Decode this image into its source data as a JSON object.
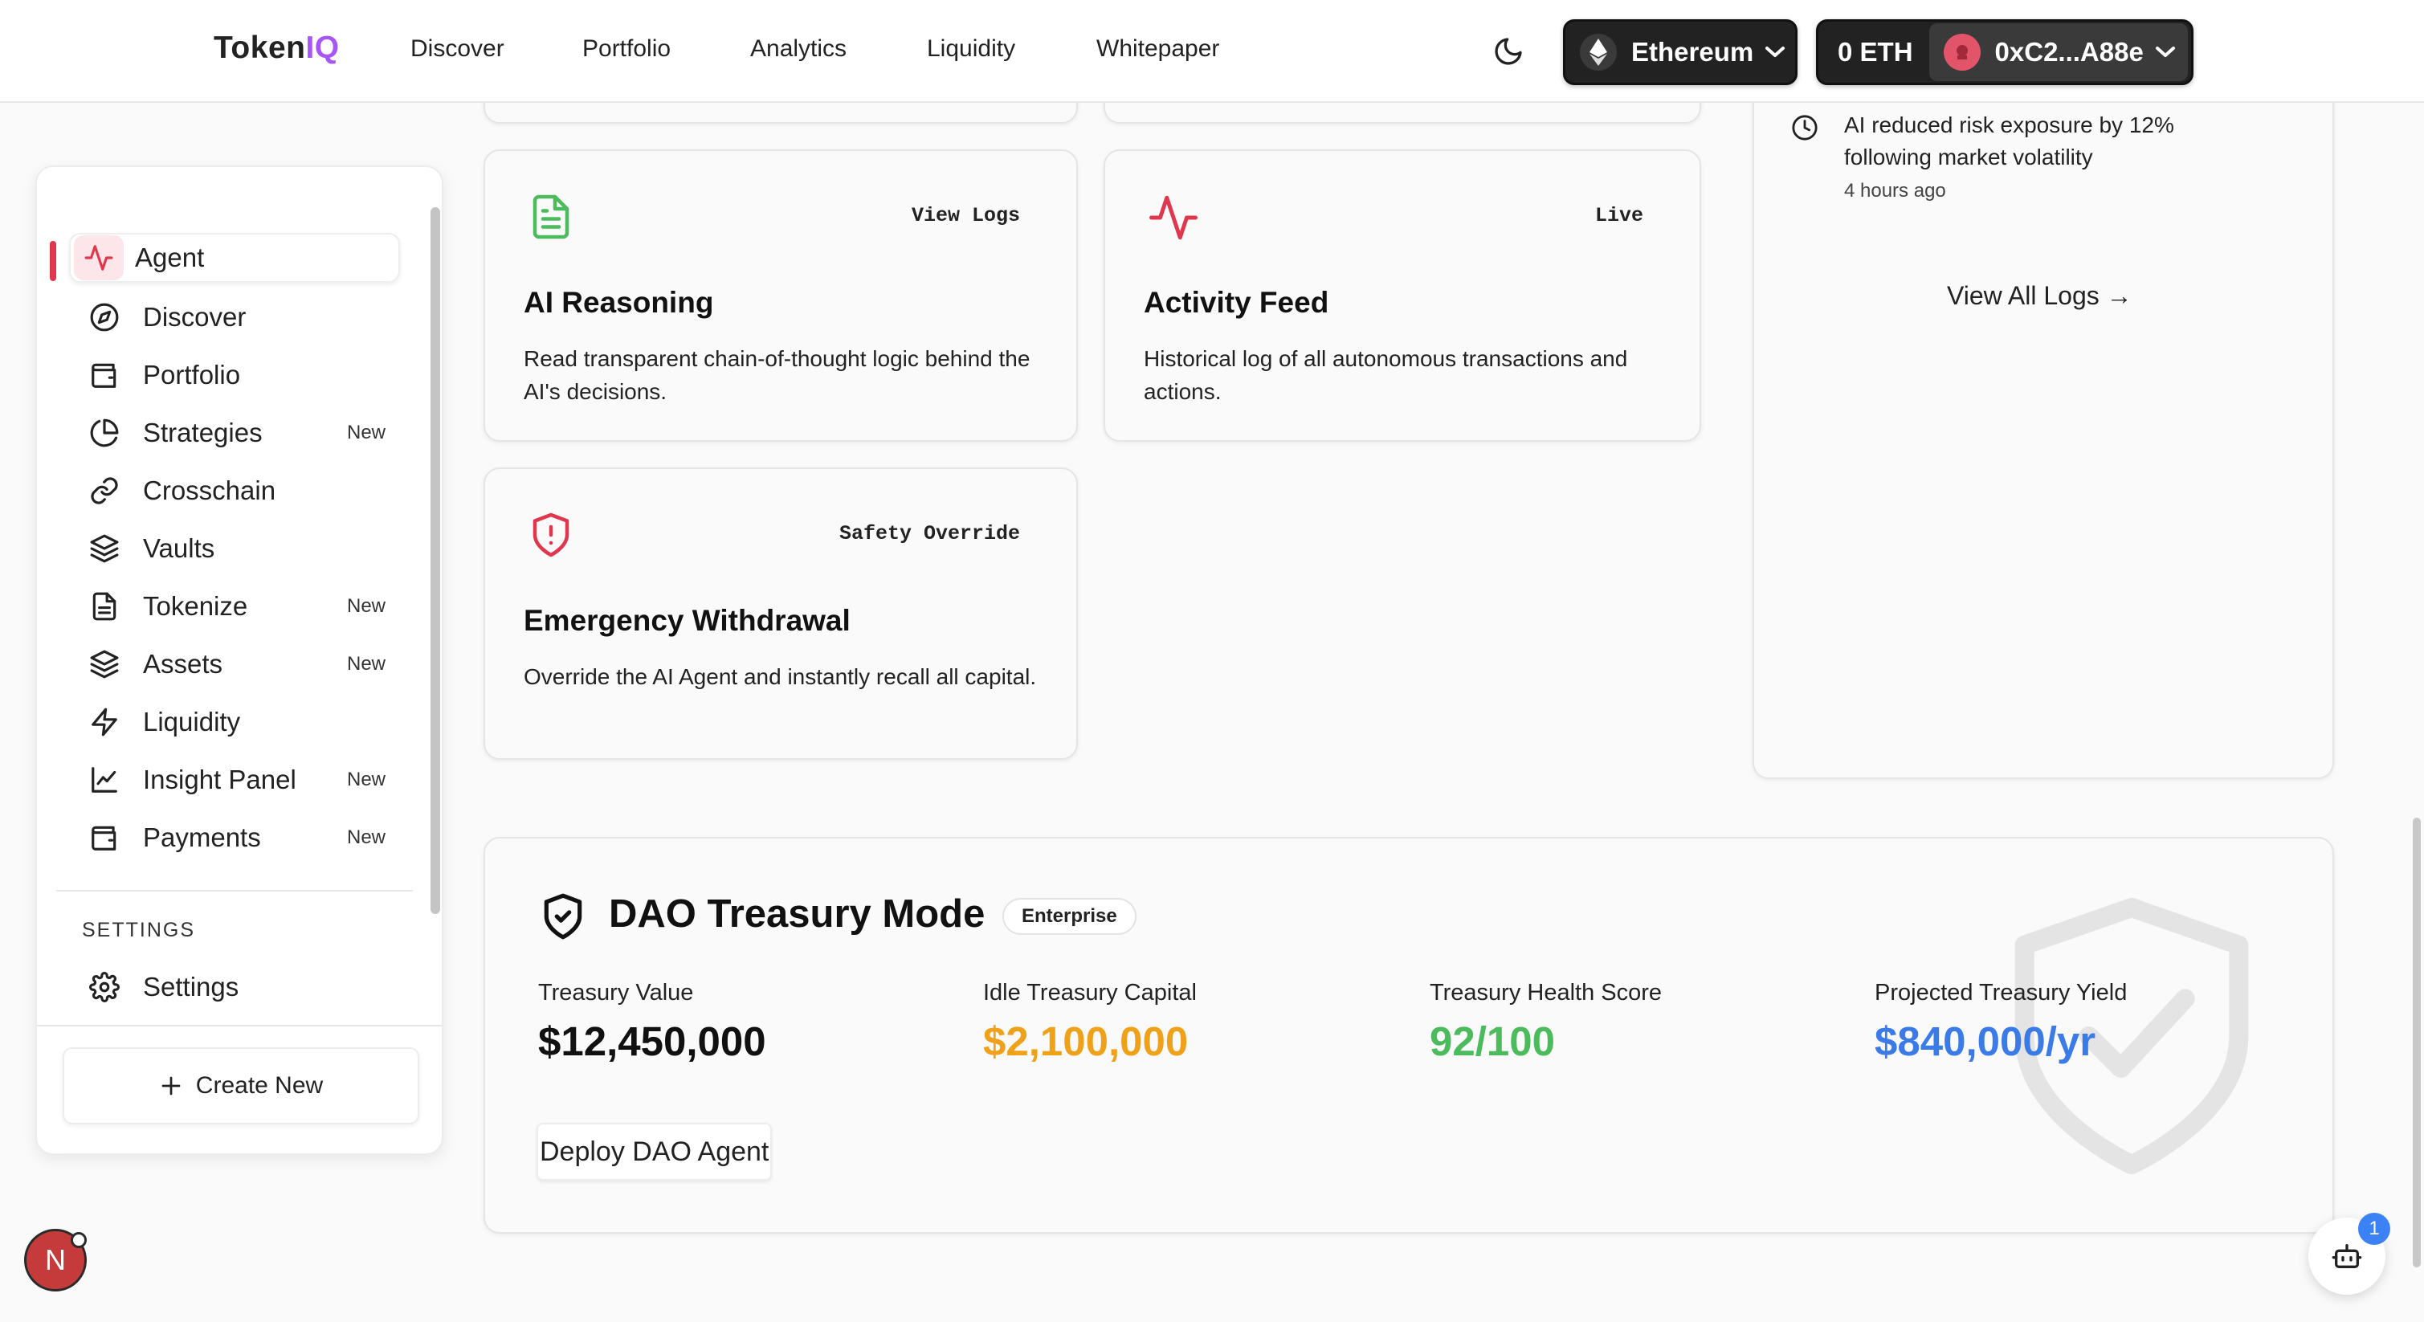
{
  "brand": {
    "part1": "Token",
    "part2": "IQ"
  },
  "nav": {
    "links": [
      "Discover",
      "Portfolio",
      "Analytics",
      "Liquidity",
      "Whitepaper"
    ]
  },
  "header": {
    "network": "Ethereum",
    "balance": "0 ETH",
    "address": "0xC2...A88e"
  },
  "sidebar": {
    "items": [
      {
        "label": "Agent",
        "badge": ""
      },
      {
        "label": "Discover",
        "badge": ""
      },
      {
        "label": "Portfolio",
        "badge": ""
      },
      {
        "label": "Strategies",
        "badge": "New"
      },
      {
        "label": "Crosschain",
        "badge": ""
      },
      {
        "label": "Vaults",
        "badge": ""
      },
      {
        "label": "Tokenize",
        "badge": "New"
      },
      {
        "label": "Assets",
        "badge": "New"
      },
      {
        "label": "Liquidity",
        "badge": ""
      },
      {
        "label": "Insight Panel",
        "badge": "New"
      },
      {
        "label": "Payments",
        "badge": "New"
      }
    ],
    "settings_heading": "SETTINGS",
    "settings_label": "Settings",
    "create_label": "Create New"
  },
  "cards": {
    "reasoning": {
      "tag": "View Logs",
      "title": "AI Reasoning",
      "desc": "Read transparent chain-of-thought logic behind the AI's decisions."
    },
    "activity": {
      "tag": "Live",
      "title": "Activity Feed",
      "desc": "Historical log of all autonomous transactions and actions."
    },
    "emergency": {
      "tag": "Safety Override",
      "title": "Emergency Withdrawal",
      "desc": "Override the AI Agent and instantly recall all capital."
    }
  },
  "logs": {
    "entry_text": "AI reduced risk exposure by 12% following market volatility",
    "entry_time": "4 hours ago",
    "view_all": "View All Logs →"
  },
  "dao": {
    "title": "DAO Treasury Mode",
    "badge": "Enterprise",
    "metrics": [
      {
        "label": "Treasury Value",
        "value": "$12,450,000",
        "color": "#111111"
      },
      {
        "label": "Idle Treasury Capital",
        "value": "$2,100,000",
        "color": "#f0a11a"
      },
      {
        "label": "Treasury Health Score",
        "value": "92/100",
        "color": "#4cbb5c"
      },
      {
        "label": "Projected Treasury Yield",
        "value": "$840,000/yr",
        "color": "#3b7be8"
      }
    ],
    "deploy_label": "Deploy DAO Agent"
  },
  "floating": {
    "user_initial": "N",
    "bot_badge": "1"
  },
  "colors": {
    "accent": "#e0374f",
    "brand_purple": "#a855f7",
    "green": "#4cbb5c",
    "header_dark": "#222222"
  }
}
